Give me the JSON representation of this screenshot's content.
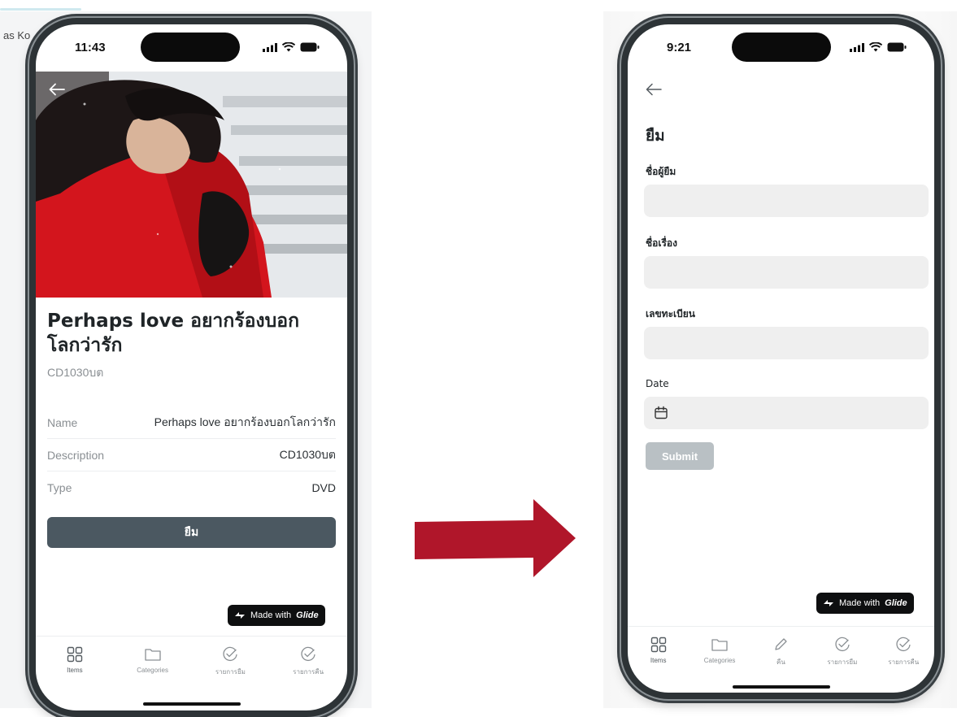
{
  "background": {
    "partial_label": "as Ko"
  },
  "screen_detail": {
    "status_time": "11:43",
    "item_title": "Perhaps love อยากร้องบอกโลกว่ารัก",
    "item_subtitle": "CD1030บต",
    "details": [
      {
        "label": "Name",
        "value": "Perhaps love อยากร้องบอกโลกว่ารัก"
      },
      {
        "label": "Description",
        "value": "CD1030บต"
      },
      {
        "label": "Type",
        "value": "DVD"
      }
    ],
    "borrow_button": "ยืม",
    "badge": {
      "prefix": "Made with",
      "brand": "Glide"
    },
    "tabs": [
      {
        "label": "Items",
        "icon": "grid-icon"
      },
      {
        "label": "Categories",
        "icon": "folder-icon"
      },
      {
        "label": "รายการยืม",
        "icon": "check-circle-icon"
      },
      {
        "label": "รายการคืน",
        "icon": "check-circle-icon"
      }
    ]
  },
  "screen_form": {
    "status_time": "9:21",
    "title": "ยืม",
    "fields": [
      {
        "label": "ชื่อผู้ยืม",
        "value": ""
      },
      {
        "label": "ชื่อเรื่อง",
        "value": ""
      },
      {
        "label": "เลขทะเบียน",
        "value": ""
      }
    ],
    "date_label": "Date",
    "submit_label": "Submit",
    "badge": {
      "prefix": "Made with",
      "brand": "Glide"
    },
    "tabs": [
      {
        "label": "Items",
        "icon": "grid-icon"
      },
      {
        "label": "Categories",
        "icon": "folder-icon"
      },
      {
        "label": "คืน",
        "icon": "pencil-icon"
      },
      {
        "label": "รายการยืม",
        "icon": "check-circle-icon"
      },
      {
        "label": "รายการคืน",
        "icon": "check-circle-icon"
      }
    ]
  },
  "colors": {
    "arrow": "#b0162a",
    "button_dark": "#4b5861",
    "button_disabled": "#b9c0c4"
  }
}
